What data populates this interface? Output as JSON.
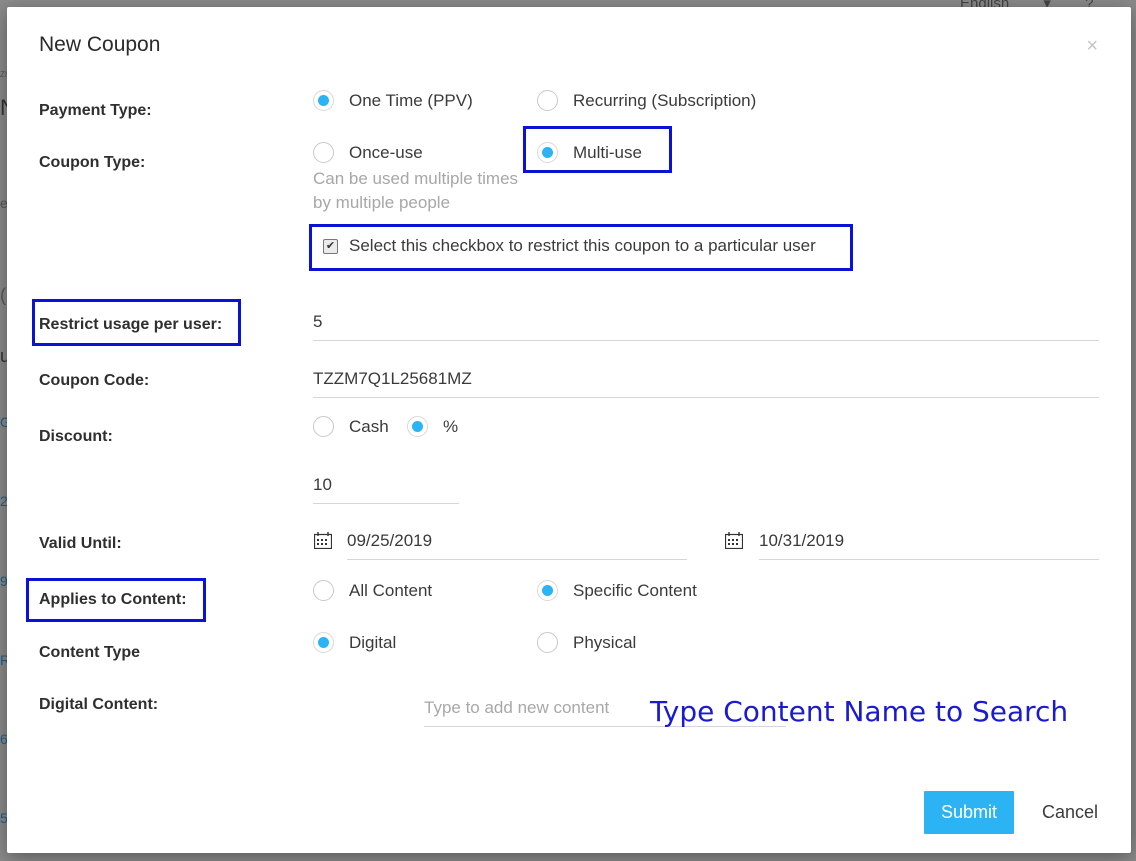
{
  "background": {
    "topbar_items": [
      "English",
      "▾",
      "?"
    ],
    "left_chars": [
      "ZI",
      "N",
      "e",
      "(",
      "u",
      "G",
      "2",
      "9",
      "R",
      "6",
      "5"
    ]
  },
  "modal": {
    "title": "New Coupon",
    "close_symbol": "×"
  },
  "payment_type": {
    "label": "Payment Type:",
    "options": [
      {
        "label": "One Time (PPV)",
        "checked": true
      },
      {
        "label": "Recurring (Subscription)",
        "checked": false
      }
    ]
  },
  "coupon_type": {
    "label": "Coupon Type:",
    "options": [
      {
        "label": "Once-use",
        "checked": false
      },
      {
        "label": "Multi-use",
        "checked": true
      }
    ],
    "hint": "Can be used multiple times by multiple people"
  },
  "restrict_checkbox": {
    "label": "Select this checkbox to restrict this coupon to a particular user",
    "checked": true
  },
  "restrict_usage": {
    "label": "Restrict usage per user:",
    "value": "5"
  },
  "coupon_code": {
    "label": "Coupon Code:",
    "value": "TZZM7Q1L25681MZ"
  },
  "discount": {
    "label": "Discount:",
    "options": [
      {
        "label": "Cash",
        "checked": false
      },
      {
        "label": "%",
        "checked": true
      }
    ],
    "value": "10"
  },
  "valid_until": {
    "label": "Valid Until:",
    "start_date": "09/25/2019",
    "end_date": "10/31/2019"
  },
  "applies_to": {
    "label": "Applies to Content:",
    "options": [
      {
        "label": "All Content",
        "checked": false
      },
      {
        "label": "Specific Content",
        "checked": true
      }
    ]
  },
  "content_type": {
    "label": "Content Type",
    "options": [
      {
        "label": "Digital",
        "checked": true
      },
      {
        "label": "Physical",
        "checked": false
      }
    ]
  },
  "digital_content": {
    "label": "Digital Content:",
    "placeholder": "Type to add new content"
  },
  "annotation": "Type Content Name to Search",
  "buttons": {
    "submit": "Submit",
    "cancel": "Cancel"
  },
  "colors": {
    "accent": "#2bb3f3",
    "highlight_box": "#0a12d6",
    "annotation_text": "#1a1ad0"
  }
}
